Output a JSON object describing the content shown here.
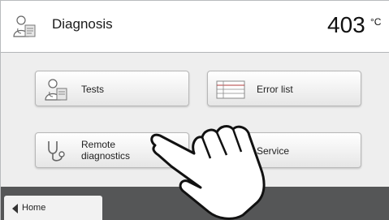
{
  "header": {
    "title": "Diagnosis",
    "icon": "doctor-icon",
    "temperature": "403",
    "unit": "°C"
  },
  "buttons": {
    "tests": {
      "label": "Tests",
      "icon": "doctor-icon"
    },
    "error_list": {
      "label": "Error list",
      "icon": "table-list-icon"
    },
    "remote": {
      "label_line1": "Remote",
      "label_line2": "diagnostics",
      "icon": "stethoscope-icon"
    },
    "service": {
      "label": "Service",
      "icon": "service-technician-icon"
    }
  },
  "footer": {
    "home_label": "Home",
    "icon": "arrow-left-icon"
  },
  "overlay": {
    "icon": "pointing-hand-icon"
  },
  "colors": {
    "header_bg": "#ffffff",
    "main_bg": "#eeeeee",
    "footer_bg": "#555657"
  }
}
